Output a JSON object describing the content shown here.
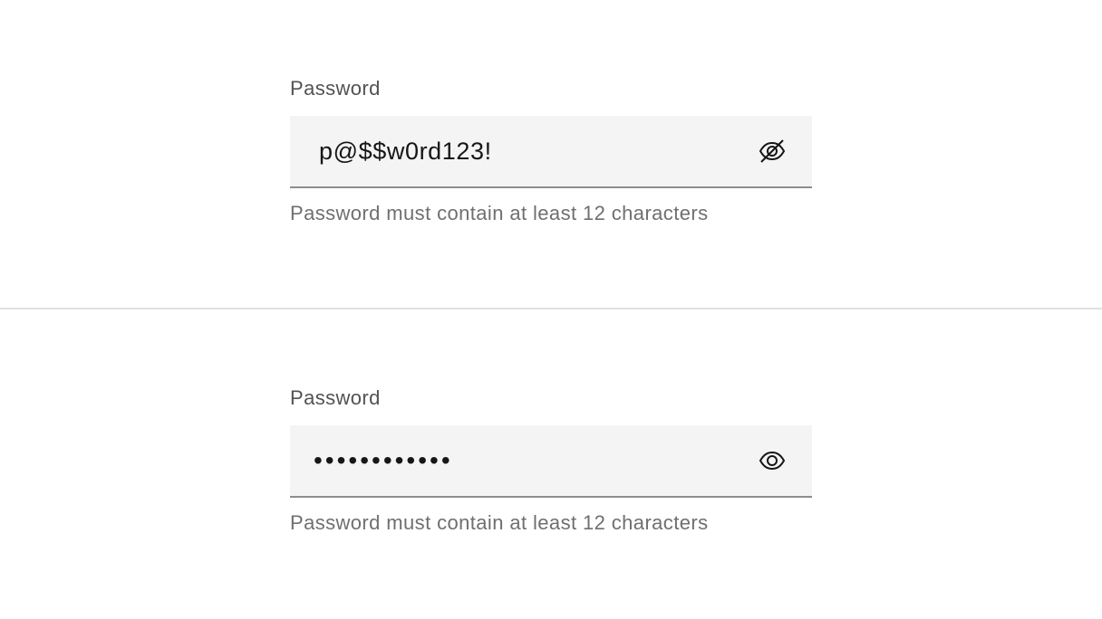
{
  "fields": [
    {
      "label": "Password",
      "value": "p@$$w0rd123!",
      "type": "text",
      "toggle_icon": "eye-off-icon",
      "helper": "Password must contain at least 12 characters"
    },
    {
      "label": "Password",
      "value": "p@$$w0rd123!",
      "type": "password",
      "toggle_icon": "eye-icon",
      "helper": "Password must contain at least 12 characters"
    }
  ],
  "colors": {
    "field_background": "#f4f4f4",
    "field_border": "#8d8d8d",
    "label": "#525252",
    "helper": "#6f6f6f",
    "text": "#161616",
    "divider": "#e0e0e0"
  }
}
